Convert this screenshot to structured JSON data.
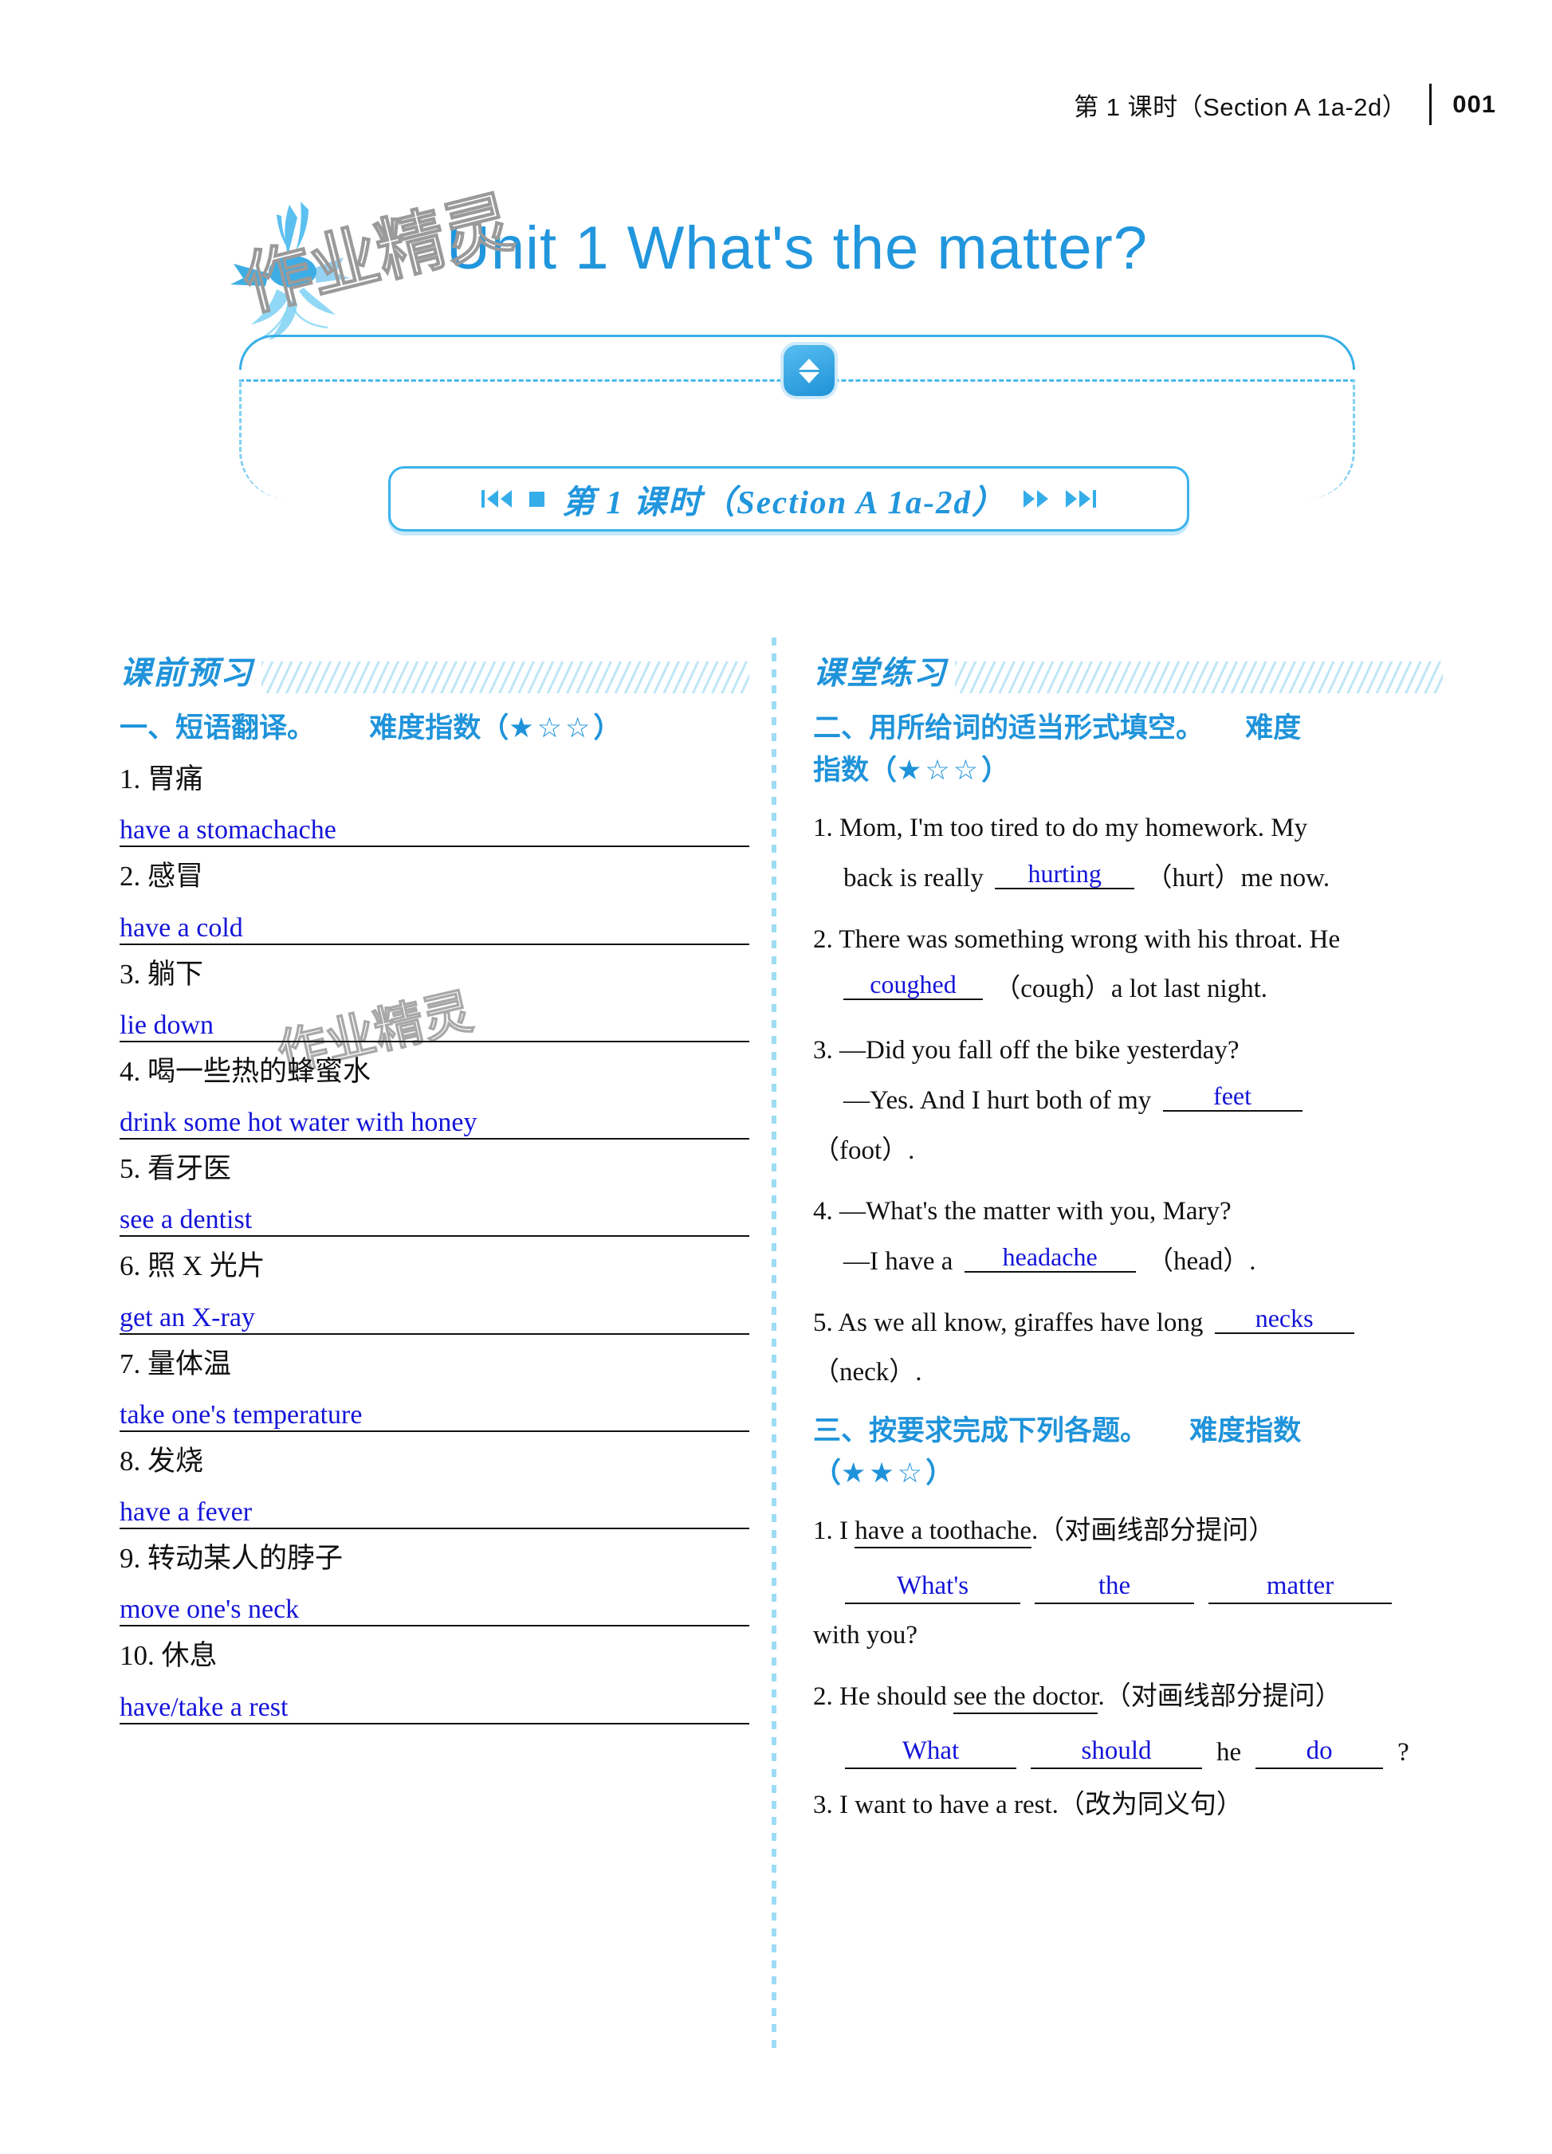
{
  "header": {
    "lesson_label": "第 1 课时（Section A 1a-2d）",
    "page_number": "001"
  },
  "unit": {
    "title": "Unit 1   What's the matter?"
  },
  "watermark": {
    "text": "作业精灵"
  },
  "lesson_chip": {
    "text": "第 1 课时（Section A 1a-2d）"
  },
  "left_column": {
    "banner": "课前预习",
    "group": {
      "heading": "一、短语翻译。",
      "level_label": "难度指数（",
      "stars": "★☆☆",
      "level_close": "）"
    },
    "items": [
      {
        "num": "1.",
        "cn": "胃痛",
        "answer": "have a stomachache"
      },
      {
        "num": "2.",
        "cn": "感冒",
        "answer": "have a cold"
      },
      {
        "num": "3.",
        "cn": "躺下",
        "answer": "lie down"
      },
      {
        "num": "4.",
        "cn": "喝一些热的蜂蜜水",
        "answer": "drink some hot water with honey"
      },
      {
        "num": "5.",
        "cn": "看牙医",
        "answer": "see a dentist"
      },
      {
        "num": "6.",
        "cn": "照 X 光片",
        "answer": "get an X-ray"
      },
      {
        "num": "7.",
        "cn": "量体温",
        "answer": "take one's temperature"
      },
      {
        "num": "8.",
        "cn": "发烧",
        "answer": "have a fever"
      },
      {
        "num": "9.",
        "cn": "转动某人的脖子",
        "answer": "move one's neck"
      },
      {
        "num": "10.",
        "cn": "休息",
        "answer": "have/take a rest"
      }
    ]
  },
  "right_column": {
    "banner": "课堂练习",
    "group2": {
      "heading": "二、用所给词的适当形式填空。",
      "level_label": "难度",
      "level_label2": "指数（",
      "stars": "★☆☆",
      "level_close": "）"
    },
    "fill_questions": [
      {
        "num": "1.",
        "part1": "Mom, I'm too tired to do my homework. My",
        "part2": "back is really",
        "answer": "hurting",
        "hint": "（hurt）me now."
      },
      {
        "num": "2.",
        "part1": "There was something wrong with his throat. He",
        "part2": "",
        "answer": "coughed",
        "hint": "（cough）a lot last night."
      },
      {
        "num": "3.",
        "part1": "—Did you fall off the bike yesterday?",
        "part2": "—Yes. And I hurt both of my",
        "answer": "feet",
        "hint": "（foot）."
      },
      {
        "num": "4.",
        "part1": "—What's the matter with you, Mary?",
        "part2": "—I have a",
        "answer": "headache",
        "hint": "（head）."
      },
      {
        "num": "5.",
        "part1": "",
        "part2": "As we all know, giraffes have long",
        "answer": "necks",
        "hint": "（neck）."
      }
    ],
    "group3": {
      "heading": "三、按要求完成下列各题。",
      "level_label": "难度指数",
      "level_open": "（",
      "stars": "★★☆",
      "level_close": "）"
    },
    "rewrite_questions": [
      {
        "num": "1.",
        "stem_plain": "I ",
        "stem_underlined": "have a toothache",
        "stem_tail": ".（对画线部分提问）",
        "answers": [
          "What's",
          "the",
          "matter"
        ],
        "continuation": "with you?"
      },
      {
        "num": "2.",
        "stem_plain": "He should ",
        "stem_underlined": "see the doctor",
        "stem_tail": ".（对画线部分提问）",
        "answers": [
          "What",
          "should",
          "do"
        ],
        "mid_word": "he",
        "tail_mark": "?"
      },
      {
        "num": "3.",
        "stem_plain": "I want to have a rest.（改为同义句）",
        "stem_underlined": "",
        "stem_tail": "",
        "answers": []
      }
    ]
  },
  "colors": {
    "brand_blue": "#2196dd",
    "answer_blue": "#1414d8",
    "ink_black": "#111111"
  }
}
